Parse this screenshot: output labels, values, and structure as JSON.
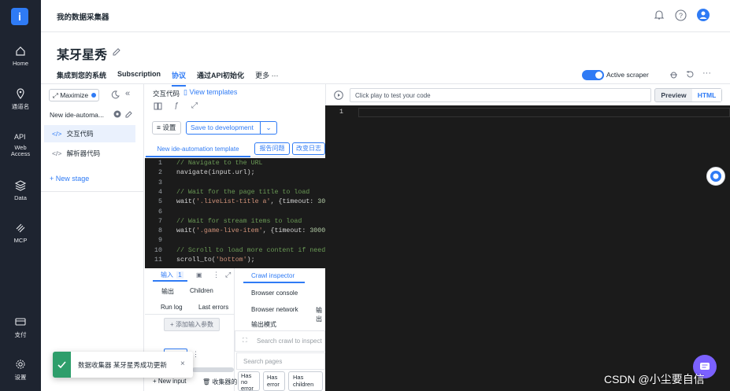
{
  "nav": {
    "logo": "i",
    "items": [
      {
        "label": "Home"
      },
      {
        "label": "通道名"
      },
      {
        "label": "Web\nAccess"
      },
      {
        "label": "Data"
      },
      {
        "label": "MCP"
      },
      {
        "label": "支付"
      },
      {
        "label": "设置"
      }
    ]
  },
  "header": {
    "title": "我的数据采集器"
  },
  "page": {
    "title": "某牙星秀",
    "tabs": [
      "集成到您的系统",
      "Subscription",
      "协议",
      "通过API初始化",
      "更多 ···"
    ],
    "active_tab_index": 2,
    "active_scraper_label": "Active scraper"
  },
  "left_panel": {
    "maximize_label": "Maximize",
    "scraper_name": "New ide-automa...",
    "items": [
      "交互代码",
      "解析器代码"
    ],
    "new_stage": "+ New stage"
  },
  "code_panel": {
    "title": "交互代码",
    "view_templates": "View templates",
    "settings_label": "设置",
    "save_label": "Save to development",
    "tabs": [
      "New ide-automation template",
      "报告问题",
      "改变日志"
    ],
    "lines": [
      {
        "n": "1",
        "text": "// Navigate to the URL",
        "kind": "comment"
      },
      {
        "n": "2",
        "text": "navigate(input.url);",
        "kind": "code"
      },
      {
        "n": "3",
        "text": "",
        "kind": "code"
      },
      {
        "n": "4",
        "text": "// Wait for the page title to load",
        "kind": "comment"
      },
      {
        "n": "5",
        "text": "wait('.liveList-title a', {timeout: 30",
        "kind": "code"
      },
      {
        "n": "6",
        "text": "",
        "kind": "code"
      },
      {
        "n": "7",
        "text": "// Wait for stream items to load",
        "kind": "comment"
      },
      {
        "n": "8",
        "text": "wait('.game-live-item', {timeout: 3000",
        "kind": "code"
      },
      {
        "n": "9",
        "text": "",
        "kind": "code"
      },
      {
        "n": "10",
        "text": "// Scroll to load more content if need",
        "kind": "comment"
      },
      {
        "n": "11",
        "text": "scroll_to('bottom');",
        "kind": "code"
      }
    ]
  },
  "bottom_left": {
    "input_tab": "输入",
    "input_count": "1",
    "output_tab": "输出",
    "children_tab": "Children",
    "runlog_tab": "Run log",
    "lasterrors_tab": "Last errors",
    "add_param": "+ 添加输入参数",
    "new_input": "+ New input",
    "collector_label": "收集器的"
  },
  "bottom_mid": {
    "crawl_inspector": "Crawl inspector",
    "browser_console": "Browser console",
    "browser_network": "Browser network",
    "extra": "输出",
    "output_mode": "输出模式",
    "search_placeholder": "Search crawl to inspect",
    "search_pages": "Search pages",
    "filters": [
      "Has\nno\nerror",
      "Has\nerror",
      "Has\nchildren"
    ]
  },
  "right_panel": {
    "play_hint": "Click play to test your code",
    "preview": "Preview",
    "html": "HTML",
    "line_number": "1"
  },
  "toast": {
    "message": "数据收集器 某牙星秀成功更新",
    "close": "×"
  },
  "watermark": "CSDN @小尘要自信",
  "colors": {
    "accent": "#2f7bf5",
    "nav_bg": "#1e2430",
    "editor_bg": "#1b1b1b",
    "success": "#2e9e6b",
    "chat_bubble": "#7b61ff"
  }
}
